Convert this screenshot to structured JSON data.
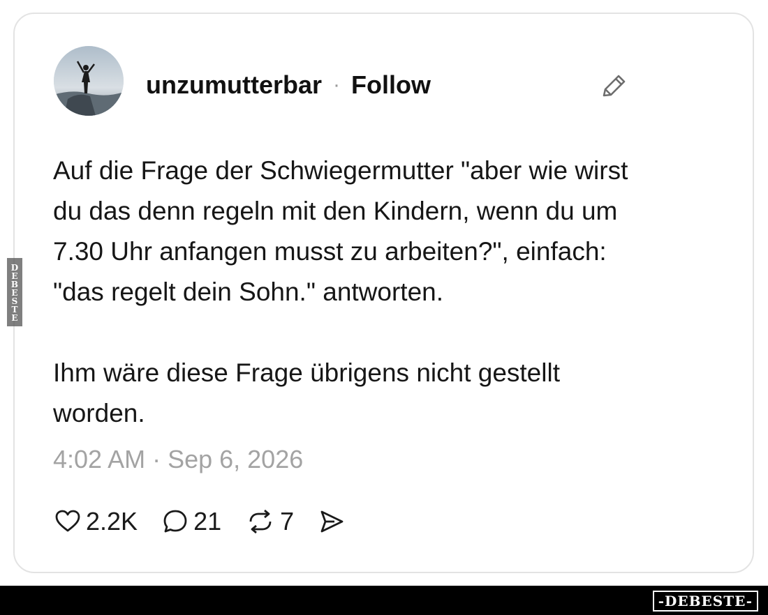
{
  "post": {
    "username": "unzumutterbar",
    "separator": "·",
    "follow_label": "Follow",
    "body_paragraph_1": [
      "Auf die Frage der Schwiegermutter \"aber wie wirst",
      "du das denn regeln mit den Kindern, wenn du um",
      "7.30 Uhr anfangen musst zu arbeiten?\", einfach:",
      "\"das regelt dein Sohn.\" antworten."
    ],
    "body_paragraph_2": [
      "Ihm wäre diese Frage übrigens nicht gestellt",
      "worden."
    ],
    "timestamp": "4:02 AM · Sep 6, 2026",
    "actions": {
      "likes": "2.2K",
      "replies": "21",
      "reposts": "7"
    }
  },
  "icons": {
    "edit": "pencil-icon",
    "like": "heart-icon",
    "reply": "speech-bubble-icon",
    "repost": "repost-icon",
    "share": "send-icon"
  },
  "watermark": {
    "side_text": "DEBESTE",
    "bottom_text": "-DEBESTE-"
  },
  "colors": {
    "text": "#111111",
    "muted": "#a3a3a3",
    "card_border": "#e3e3e3",
    "bottom_bar": "#000000"
  }
}
